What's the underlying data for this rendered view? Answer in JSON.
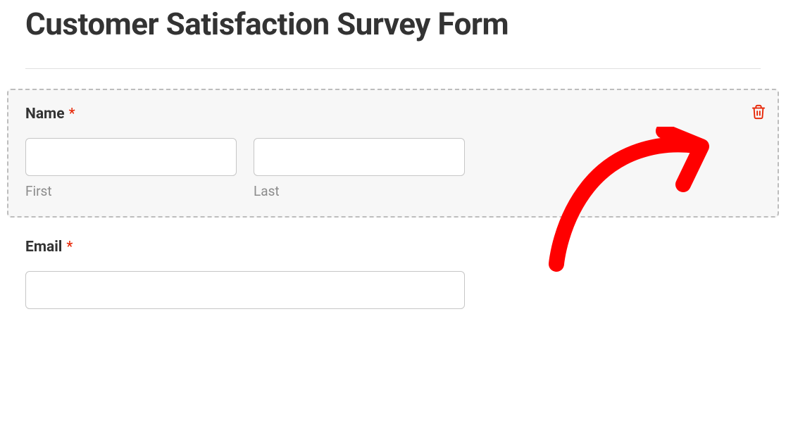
{
  "title": "Customer Satisfaction Survey Form",
  "fields": {
    "name": {
      "label": "Name",
      "required_marker": "*",
      "first": {
        "value": "",
        "sublabel": "First"
      },
      "last": {
        "value": "",
        "sublabel": "Last"
      }
    },
    "email": {
      "label": "Email",
      "required_marker": "*",
      "value": ""
    }
  },
  "colors": {
    "required": "#e72200",
    "text": "#333333",
    "border": "#c6c6c6",
    "sublabel": "#8c8c8c",
    "selected_bg": "#f7f7f7"
  }
}
